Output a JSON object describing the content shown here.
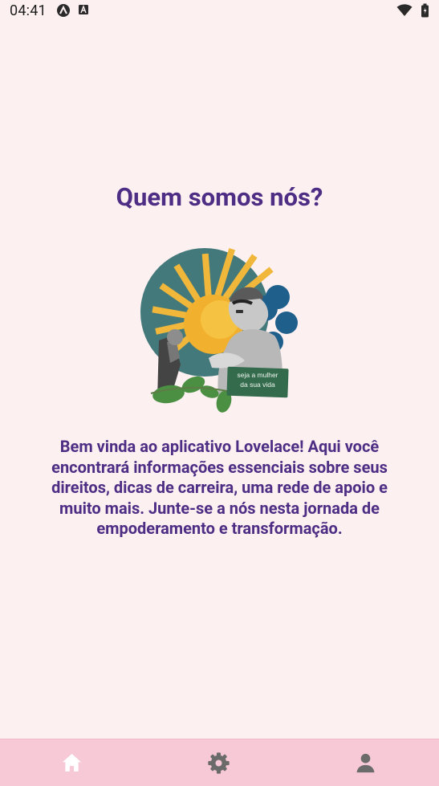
{
  "status_bar": {
    "time": "04:41",
    "icons": [
      "app-notification-icon",
      "text-notification-icon",
      "wifi-icon",
      "battery-icon"
    ]
  },
  "page": {
    "title": "Quem somos nós?",
    "image_caption": "seja a mulher da sua vida",
    "description": "Bem vinda ao aplicativo Lovelace! Aqui você encontrará informações essenciais sobre seus direitos, dicas de carreira, uma rede de apoio e muito mais. Junte-se a nós nesta jornada de empoderamento e transformação."
  },
  "bottom_nav": {
    "items": [
      {
        "icon": "home-icon"
      },
      {
        "icon": "settings-icon"
      },
      {
        "icon": "profile-icon"
      }
    ]
  },
  "colors": {
    "background": "#fcf0f1",
    "accent_text": "#4e2d84",
    "nav_background": "#f7c8d6",
    "nav_icon": "#6b6b6b",
    "nav_icon_active": "#ffffff"
  }
}
